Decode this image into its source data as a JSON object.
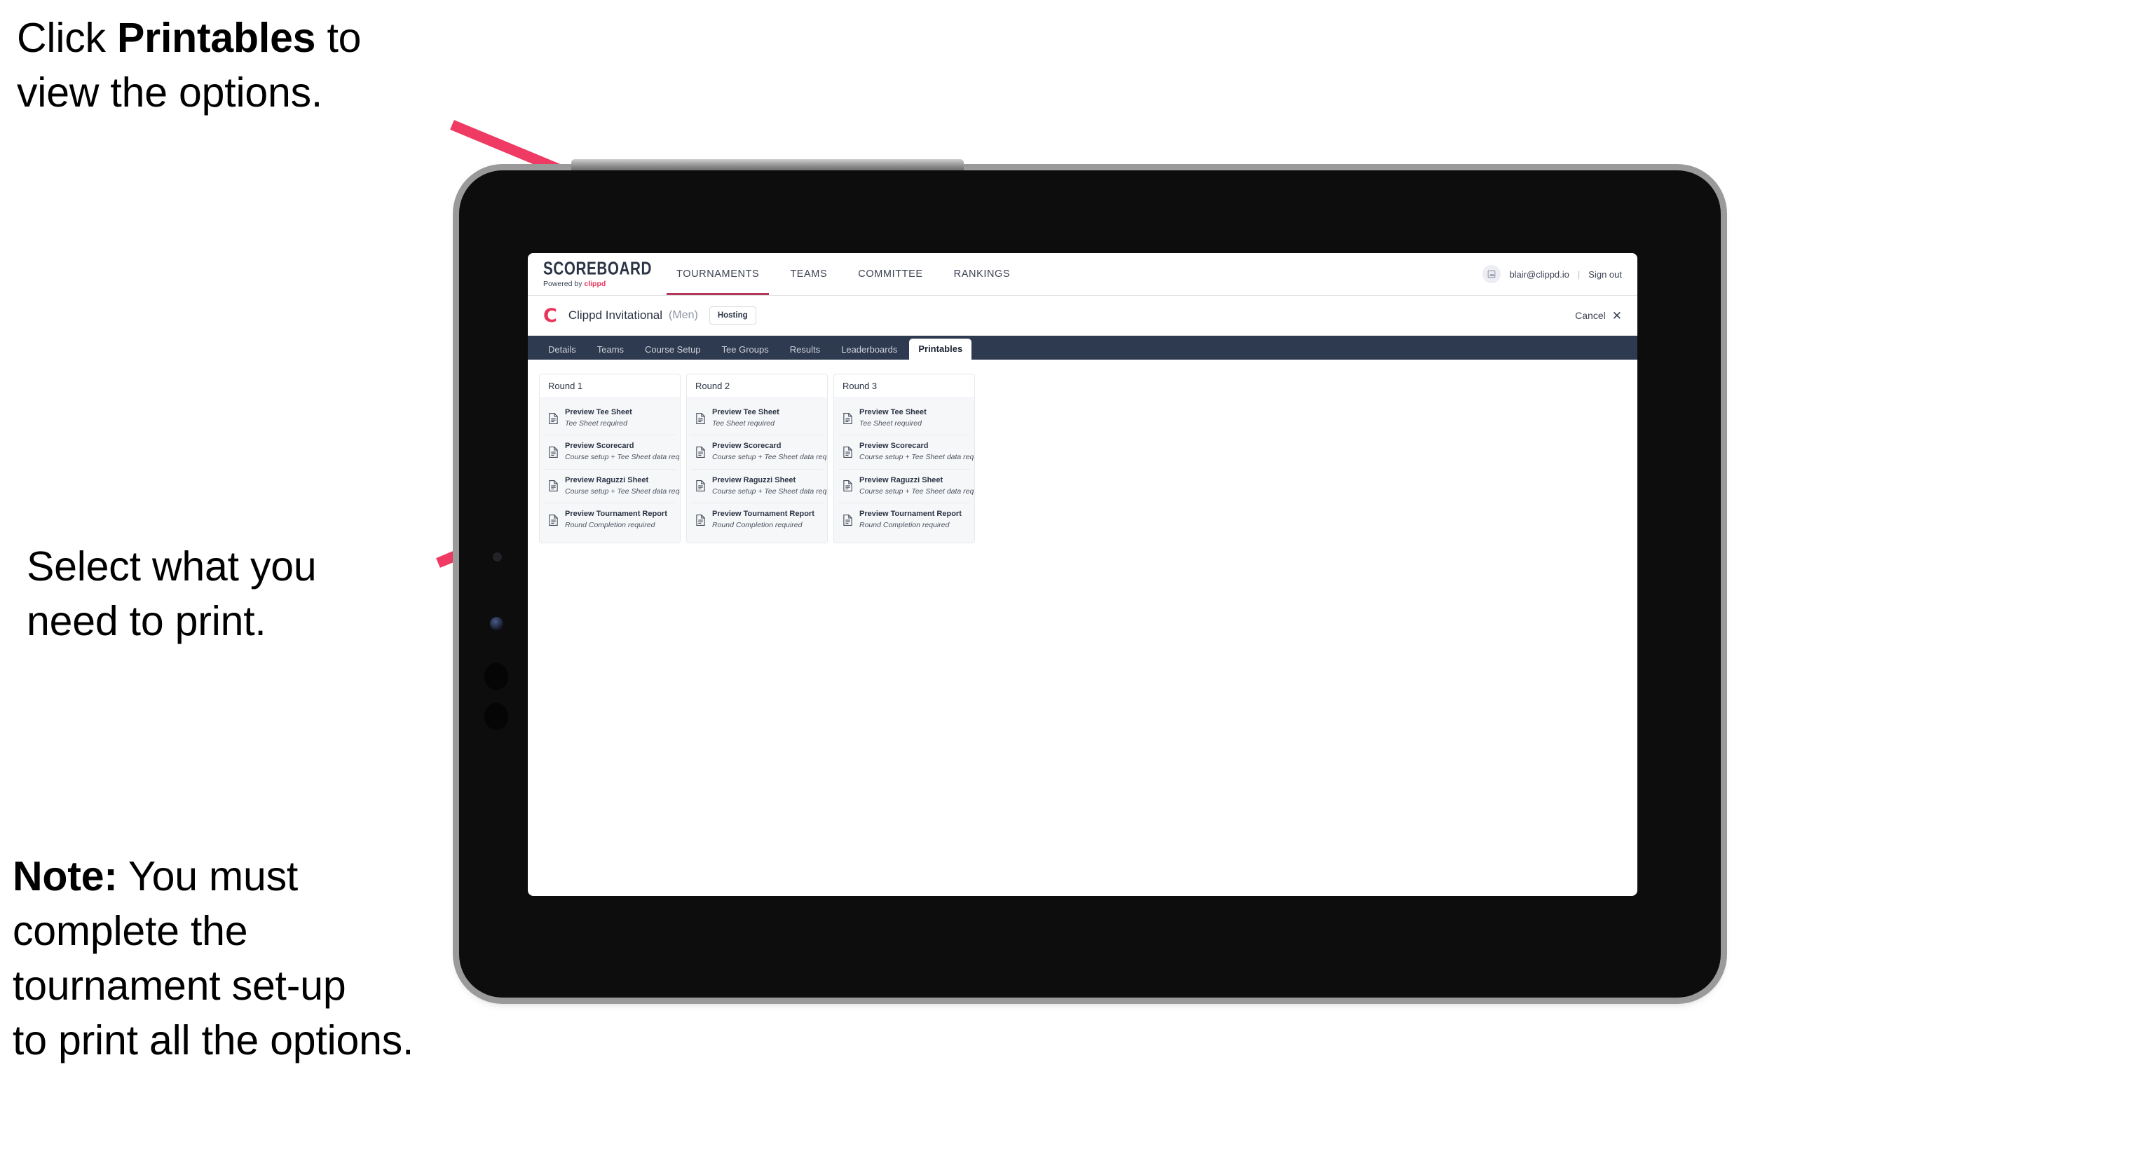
{
  "annotations": {
    "top": "Click **Printables** to\nview the options.",
    "top_plain_a": "Click ",
    "top_bold": "Printables",
    "top_plain_b": " to\nview the options.",
    "middle": "Select what you\n need to print.",
    "note_bold": "Note:",
    "note_rest": " You must\ncomplete the\ntournament set-up\nto print all the options."
  },
  "colors": {
    "arrow_pink": "#ef3a63",
    "brand_pink": "#e8345a",
    "tabbar_navy": "#2e3a4f",
    "tablet_body": "#0d0d0d",
    "tablet_frame": "#9a9a9a"
  },
  "app": {
    "logo": {
      "word": "SCOREBOARD",
      "powered_prefix": "Powered by ",
      "powered_brand": "clippd"
    },
    "top_nav": [
      {
        "label": "TOURNAMENTS",
        "active": true
      },
      {
        "label": "TEAMS",
        "active": false
      },
      {
        "label": "COMMITTEE",
        "active": false
      },
      {
        "label": "RANKINGS",
        "active": false
      }
    ],
    "account": {
      "avatar_icon": "user-avatar-icon",
      "email": "blair@clippd.io",
      "separator": "|",
      "sign_out": "Sign out"
    },
    "tournament": {
      "logo_letter": "C",
      "name": "Clippd Invitational",
      "gender": "(Men)",
      "badge": "Hosting",
      "cancel_label": "Cancel",
      "cancel_icon": "close-x-icon"
    },
    "tabs": [
      {
        "label": "Details",
        "active": false
      },
      {
        "label": "Teams",
        "active": false
      },
      {
        "label": "Course Setup",
        "active": false
      },
      {
        "label": "Tee Groups",
        "active": false
      },
      {
        "label": "Results",
        "active": false
      },
      {
        "label": "Leaderboards",
        "active": false
      },
      {
        "label": "Printables",
        "active": true
      }
    ],
    "rounds": [
      {
        "title": "Round 1",
        "items": [
          {
            "icon": "document-icon",
            "title": "Preview Tee Sheet",
            "subtitle": "Tee Sheet required"
          },
          {
            "icon": "document-icon",
            "title": "Preview Scorecard",
            "subtitle": "Course setup + Tee Sheet data required"
          },
          {
            "icon": "document-icon",
            "title": "Preview Raguzzi Sheet",
            "subtitle": "Course setup + Tee Sheet data required"
          },
          {
            "icon": "document-icon",
            "title": "Preview Tournament Report",
            "subtitle": "Round Completion required"
          }
        ]
      },
      {
        "title": "Round 2",
        "items": [
          {
            "icon": "document-icon",
            "title": "Preview Tee Sheet",
            "subtitle": "Tee Sheet required"
          },
          {
            "icon": "document-icon",
            "title": "Preview Scorecard",
            "subtitle": "Course setup + Tee Sheet data required"
          },
          {
            "icon": "document-icon",
            "title": "Preview Raguzzi Sheet",
            "subtitle": "Course setup + Tee Sheet data required"
          },
          {
            "icon": "document-icon",
            "title": "Preview Tournament Report",
            "subtitle": "Round Completion required"
          }
        ]
      },
      {
        "title": "Round 3",
        "items": [
          {
            "icon": "document-icon",
            "title": "Preview Tee Sheet",
            "subtitle": "Tee Sheet required"
          },
          {
            "icon": "document-icon",
            "title": "Preview Scorecard",
            "subtitle": "Course setup + Tee Sheet data required"
          },
          {
            "icon": "document-icon",
            "title": "Preview Raguzzi Sheet",
            "subtitle": "Course setup + Tee Sheet data required"
          },
          {
            "icon": "document-icon",
            "title": "Preview Tournament Report",
            "subtitle": "Round Completion required"
          }
        ]
      }
    ]
  }
}
